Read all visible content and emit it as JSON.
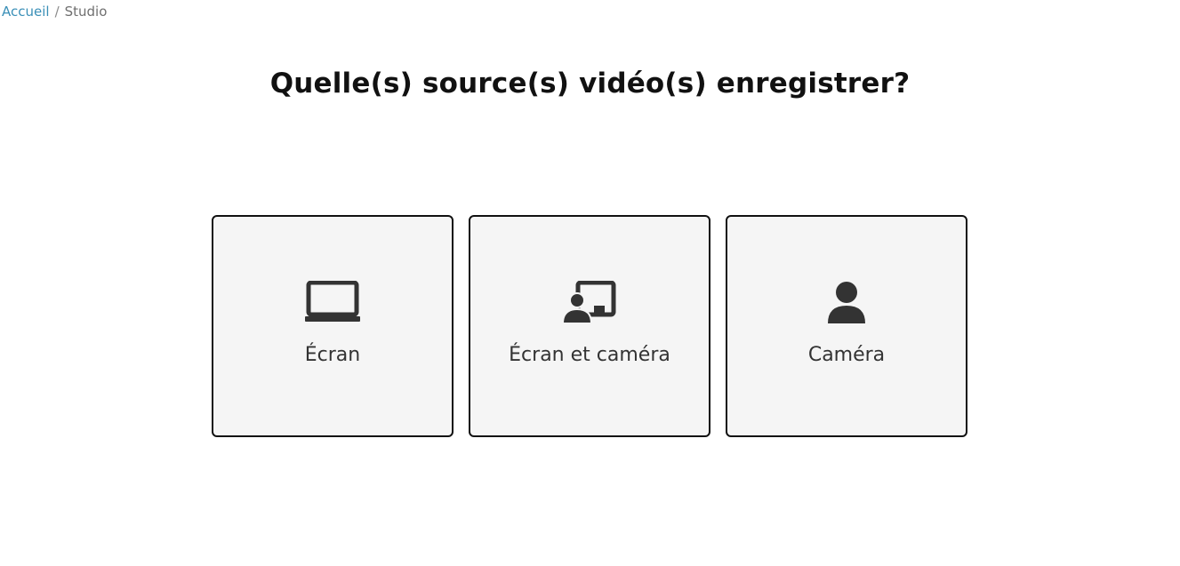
{
  "breadcrumb": {
    "home": "Accueil",
    "separator": "/",
    "current": "Studio"
  },
  "page": {
    "title": "Quelle(s) source(s) vidéo(s) enregistrer?"
  },
  "options": [
    {
      "label": "Écran",
      "icon": "laptop-icon"
    },
    {
      "label": "Écran et caméra",
      "icon": "screen-and-camera-icon"
    },
    {
      "label": "Caméra",
      "icon": "user-icon"
    }
  ],
  "colors": {
    "link": "#3a8fb7",
    "card_bg": "#f5f5f5",
    "card_border": "#111111",
    "icon": "#333333"
  }
}
